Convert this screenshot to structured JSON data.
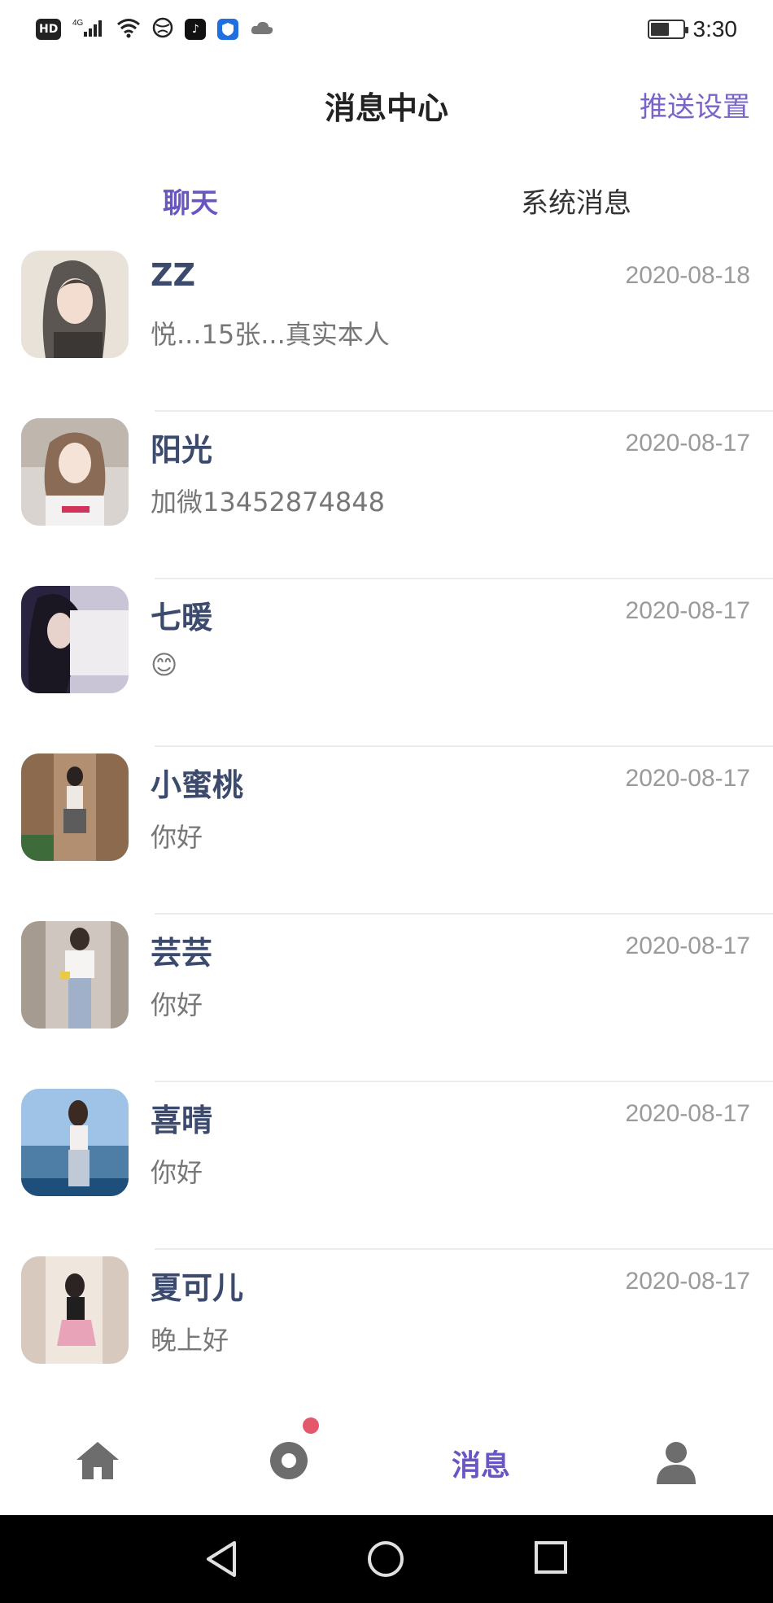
{
  "status_bar": {
    "hd": "HD",
    "net": "4G",
    "time": "3:30",
    "battery_level": 0.6
  },
  "header": {
    "title": "消息中心",
    "action": "推送设置"
  },
  "tabs": [
    {
      "label": "聊天",
      "active": true
    },
    {
      "label": "系统消息",
      "active": false
    }
  ],
  "chats": [
    {
      "name": "ZZ",
      "date": "2020-08-18",
      "message": "悦...15张...真实本人"
    },
    {
      "name": "阳光",
      "date": "2020-08-17",
      "message": "加微13452874848"
    },
    {
      "name": "七暖",
      "date": "2020-08-17",
      "message": "😊"
    },
    {
      "name": "小蜜桃",
      "date": "2020-08-17",
      "message": "你好"
    },
    {
      "name": "芸芸",
      "date": "2020-08-17",
      "message": "你好"
    },
    {
      "name": "喜晴",
      "date": "2020-08-17",
      "message": "你好"
    },
    {
      "name": "夏可儿",
      "date": "2020-08-17",
      "message": "晚上好"
    }
  ],
  "bottom_nav": {
    "message_label": "消息",
    "icons": [
      "home-icon",
      "discover-icon",
      "messages",
      "profile-icon"
    ]
  },
  "colors": {
    "accent": "#6a55c4",
    "name_text": "#3c4a6e",
    "badge": "#e4586c"
  }
}
